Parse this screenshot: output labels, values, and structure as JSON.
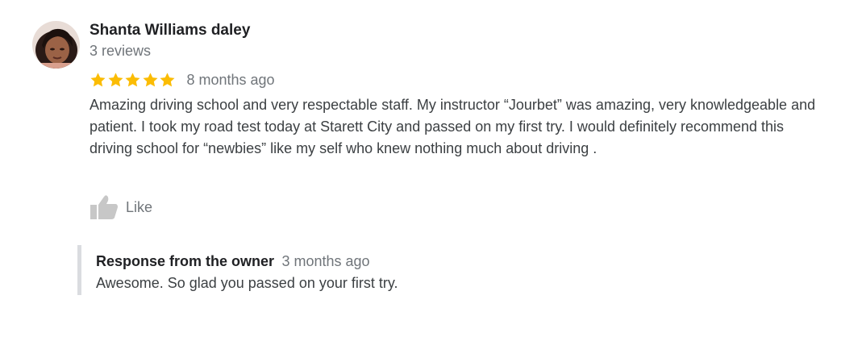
{
  "review": {
    "author_name": "Shanta Williams daley",
    "review_count": "3 reviews",
    "rating": 5,
    "rating_max": 5,
    "star_color": "#fbbc04",
    "time_ago": "8 months ago",
    "text": "Amazing driving school and very respectable staff. My instructor “Jourbet” was amazing, very knowledgeable and patient. I took my road test today at Starett City and passed on my first try. I would definitely recommend this driving school for “newbies”  like my self who knew nothing much about driving .",
    "like_label": "Like",
    "like_icon": "thumbs-up-icon"
  },
  "owner_response": {
    "label": "Response from the owner",
    "time_ago": "3 months ago",
    "text": "Awesome. So glad you passed on your first try."
  }
}
